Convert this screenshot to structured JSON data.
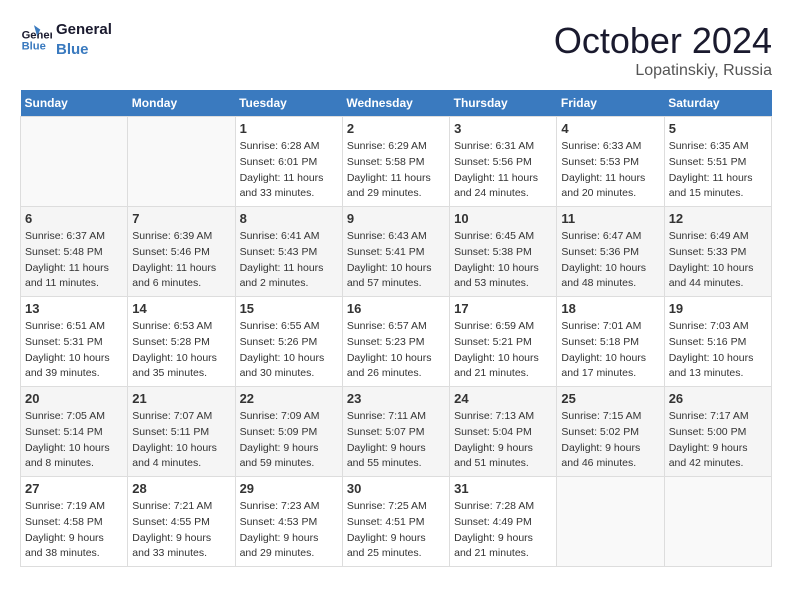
{
  "header": {
    "logo": {
      "line1": "General",
      "line2": "Blue"
    },
    "title": "October 2024",
    "location": "Lopatinskiy, Russia"
  },
  "columns": [
    "Sunday",
    "Monday",
    "Tuesday",
    "Wednesday",
    "Thursday",
    "Friday",
    "Saturday"
  ],
  "weeks": [
    [
      {
        "day": "",
        "sunrise": "",
        "sunset": "",
        "daylight": ""
      },
      {
        "day": "",
        "sunrise": "",
        "sunset": "",
        "daylight": ""
      },
      {
        "day": "1",
        "sunrise": "Sunrise: 6:28 AM",
        "sunset": "Sunset: 6:01 PM",
        "daylight": "Daylight: 11 hours and 33 minutes."
      },
      {
        "day": "2",
        "sunrise": "Sunrise: 6:29 AM",
        "sunset": "Sunset: 5:58 PM",
        "daylight": "Daylight: 11 hours and 29 minutes."
      },
      {
        "day": "3",
        "sunrise": "Sunrise: 6:31 AM",
        "sunset": "Sunset: 5:56 PM",
        "daylight": "Daylight: 11 hours and 24 minutes."
      },
      {
        "day": "4",
        "sunrise": "Sunrise: 6:33 AM",
        "sunset": "Sunset: 5:53 PM",
        "daylight": "Daylight: 11 hours and 20 minutes."
      },
      {
        "day": "5",
        "sunrise": "Sunrise: 6:35 AM",
        "sunset": "Sunset: 5:51 PM",
        "daylight": "Daylight: 11 hours and 15 minutes."
      }
    ],
    [
      {
        "day": "6",
        "sunrise": "Sunrise: 6:37 AM",
        "sunset": "Sunset: 5:48 PM",
        "daylight": "Daylight: 11 hours and 11 minutes."
      },
      {
        "day": "7",
        "sunrise": "Sunrise: 6:39 AM",
        "sunset": "Sunset: 5:46 PM",
        "daylight": "Daylight: 11 hours and 6 minutes."
      },
      {
        "day": "8",
        "sunrise": "Sunrise: 6:41 AM",
        "sunset": "Sunset: 5:43 PM",
        "daylight": "Daylight: 11 hours and 2 minutes."
      },
      {
        "day": "9",
        "sunrise": "Sunrise: 6:43 AM",
        "sunset": "Sunset: 5:41 PM",
        "daylight": "Daylight: 10 hours and 57 minutes."
      },
      {
        "day": "10",
        "sunrise": "Sunrise: 6:45 AM",
        "sunset": "Sunset: 5:38 PM",
        "daylight": "Daylight: 10 hours and 53 minutes."
      },
      {
        "day": "11",
        "sunrise": "Sunrise: 6:47 AM",
        "sunset": "Sunset: 5:36 PM",
        "daylight": "Daylight: 10 hours and 48 minutes."
      },
      {
        "day": "12",
        "sunrise": "Sunrise: 6:49 AM",
        "sunset": "Sunset: 5:33 PM",
        "daylight": "Daylight: 10 hours and 44 minutes."
      }
    ],
    [
      {
        "day": "13",
        "sunrise": "Sunrise: 6:51 AM",
        "sunset": "Sunset: 5:31 PM",
        "daylight": "Daylight: 10 hours and 39 minutes."
      },
      {
        "day": "14",
        "sunrise": "Sunrise: 6:53 AM",
        "sunset": "Sunset: 5:28 PM",
        "daylight": "Daylight: 10 hours and 35 minutes."
      },
      {
        "day": "15",
        "sunrise": "Sunrise: 6:55 AM",
        "sunset": "Sunset: 5:26 PM",
        "daylight": "Daylight: 10 hours and 30 minutes."
      },
      {
        "day": "16",
        "sunrise": "Sunrise: 6:57 AM",
        "sunset": "Sunset: 5:23 PM",
        "daylight": "Daylight: 10 hours and 26 minutes."
      },
      {
        "day": "17",
        "sunrise": "Sunrise: 6:59 AM",
        "sunset": "Sunset: 5:21 PM",
        "daylight": "Daylight: 10 hours and 21 minutes."
      },
      {
        "day": "18",
        "sunrise": "Sunrise: 7:01 AM",
        "sunset": "Sunset: 5:18 PM",
        "daylight": "Daylight: 10 hours and 17 minutes."
      },
      {
        "day": "19",
        "sunrise": "Sunrise: 7:03 AM",
        "sunset": "Sunset: 5:16 PM",
        "daylight": "Daylight: 10 hours and 13 minutes."
      }
    ],
    [
      {
        "day": "20",
        "sunrise": "Sunrise: 7:05 AM",
        "sunset": "Sunset: 5:14 PM",
        "daylight": "Daylight: 10 hours and 8 minutes."
      },
      {
        "day": "21",
        "sunrise": "Sunrise: 7:07 AM",
        "sunset": "Sunset: 5:11 PM",
        "daylight": "Daylight: 10 hours and 4 minutes."
      },
      {
        "day": "22",
        "sunrise": "Sunrise: 7:09 AM",
        "sunset": "Sunset: 5:09 PM",
        "daylight": "Daylight: 9 hours and 59 minutes."
      },
      {
        "day": "23",
        "sunrise": "Sunrise: 7:11 AM",
        "sunset": "Sunset: 5:07 PM",
        "daylight": "Daylight: 9 hours and 55 minutes."
      },
      {
        "day": "24",
        "sunrise": "Sunrise: 7:13 AM",
        "sunset": "Sunset: 5:04 PM",
        "daylight": "Daylight: 9 hours and 51 minutes."
      },
      {
        "day": "25",
        "sunrise": "Sunrise: 7:15 AM",
        "sunset": "Sunset: 5:02 PM",
        "daylight": "Daylight: 9 hours and 46 minutes."
      },
      {
        "day": "26",
        "sunrise": "Sunrise: 7:17 AM",
        "sunset": "Sunset: 5:00 PM",
        "daylight": "Daylight: 9 hours and 42 minutes."
      }
    ],
    [
      {
        "day": "27",
        "sunrise": "Sunrise: 7:19 AM",
        "sunset": "Sunset: 4:58 PM",
        "daylight": "Daylight: 9 hours and 38 minutes."
      },
      {
        "day": "28",
        "sunrise": "Sunrise: 7:21 AM",
        "sunset": "Sunset: 4:55 PM",
        "daylight": "Daylight: 9 hours and 33 minutes."
      },
      {
        "day": "29",
        "sunrise": "Sunrise: 7:23 AM",
        "sunset": "Sunset: 4:53 PM",
        "daylight": "Daylight: 9 hours and 29 minutes."
      },
      {
        "day": "30",
        "sunrise": "Sunrise: 7:25 AM",
        "sunset": "Sunset: 4:51 PM",
        "daylight": "Daylight: 9 hours and 25 minutes."
      },
      {
        "day": "31",
        "sunrise": "Sunrise: 7:28 AM",
        "sunset": "Sunset: 4:49 PM",
        "daylight": "Daylight: 9 hours and 21 minutes."
      },
      {
        "day": "",
        "sunrise": "",
        "sunset": "",
        "daylight": ""
      },
      {
        "day": "",
        "sunrise": "",
        "sunset": "",
        "daylight": ""
      }
    ]
  ]
}
